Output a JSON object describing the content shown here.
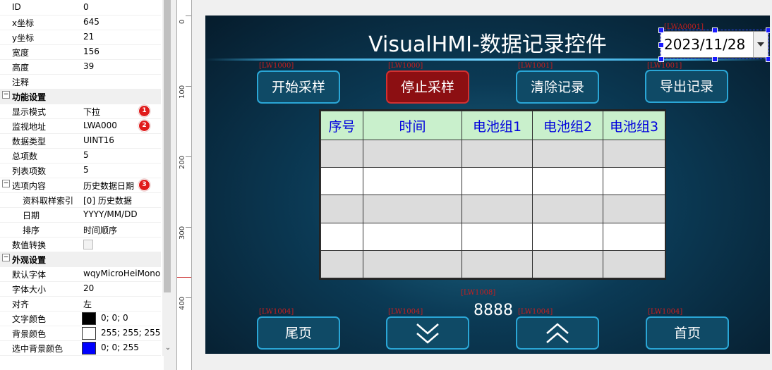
{
  "properties": {
    "rows_top": [
      {
        "key": "ID",
        "value": "0"
      },
      {
        "key": "x坐标",
        "value": "645"
      },
      {
        "key": "y坐标",
        "value": "21"
      },
      {
        "key": "宽度",
        "value": "156"
      },
      {
        "key": "高度",
        "value": "39"
      },
      {
        "key": "注释",
        "value": ""
      }
    ],
    "group_func": {
      "label": "功能设置",
      "toggle": "−"
    },
    "func_rows": [
      {
        "key": "显示模式",
        "value": "下拉",
        "badge": "1"
      },
      {
        "key": "监视地址",
        "value": "LWA000",
        "badge": "2"
      },
      {
        "key": "数据类型",
        "value": "UINT16"
      },
      {
        "key": "总项数",
        "value": "5"
      },
      {
        "key": "列表项数",
        "value": "5"
      },
      {
        "key": "选项内容",
        "value": "历史数据日期",
        "badge": "3",
        "toggle": "−"
      }
    ],
    "sub_rows": [
      {
        "key": "资料取样索引",
        "value": "[0] 历史数据"
      },
      {
        "key": "日期",
        "value": "YYYY/MM/DD"
      },
      {
        "key": "排序",
        "value": "时间顺序"
      }
    ],
    "value_convert": {
      "key": "数值转换",
      "checked": false
    },
    "group_look": {
      "label": "外观设置",
      "toggle": "−"
    },
    "look_rows": [
      {
        "key": "默认字体",
        "value": "wqyMicroHeiMono"
      },
      {
        "key": "字体大小",
        "value": "20"
      },
      {
        "key": "对齐",
        "value": "左"
      }
    ],
    "color_rows": [
      {
        "key": "文字颜色",
        "value": "0; 0; 0",
        "color": "#000000"
      },
      {
        "key": "背景颜色",
        "value": "255; 255; 255",
        "color": "#ffffff"
      },
      {
        "key": "选中背景颜色",
        "value": "0; 0; 255",
        "color": "#0000ff"
      }
    ],
    "scroll_down_glyph": "⌄"
  },
  "ruler": {
    "labels": [
      "0",
      "100",
      "200",
      "300",
      "400"
    ]
  },
  "hmi": {
    "title": "VisualHMI-数据记录控件",
    "date_tag": "[LWA0001]",
    "date_value": "2023/11/28",
    "buttons_top": [
      {
        "label": "开始采样",
        "tag": "[LW1000]",
        "variant": "normal"
      },
      {
        "label": "停止采样",
        "tag": "[LW1000]",
        "variant": "red"
      },
      {
        "label": "清除记录",
        "tag": "[LW1001]",
        "variant": "normal"
      },
      {
        "label": "导出记录",
        "tag": "[LW1001]",
        "variant": "normal"
      }
    ],
    "table": {
      "headers": [
        "序号",
        "时间",
        "电池组1",
        "电池组2",
        "电池组3"
      ],
      "rows": 5
    },
    "counter_tag": "[LW1008]",
    "counter_value": "8888",
    "buttons_bottom": [
      {
        "label": "尾页",
        "tag": "[LW1004]",
        "icon": ""
      },
      {
        "label": "",
        "tag": "[LW1004]",
        "icon": "page-down-icon"
      },
      {
        "label": "",
        "tag": "[LW1004]",
        "icon": "page-up-icon"
      },
      {
        "label": "首页",
        "tag": "[LW1004]",
        "icon": ""
      }
    ]
  },
  "colors": {
    "canvas_bg": "#0b3a55",
    "accent": "#2aa6d6",
    "stop_red": "#8c0f12",
    "table_header": "#c9f0cc",
    "header_text": "#0000dd"
  }
}
